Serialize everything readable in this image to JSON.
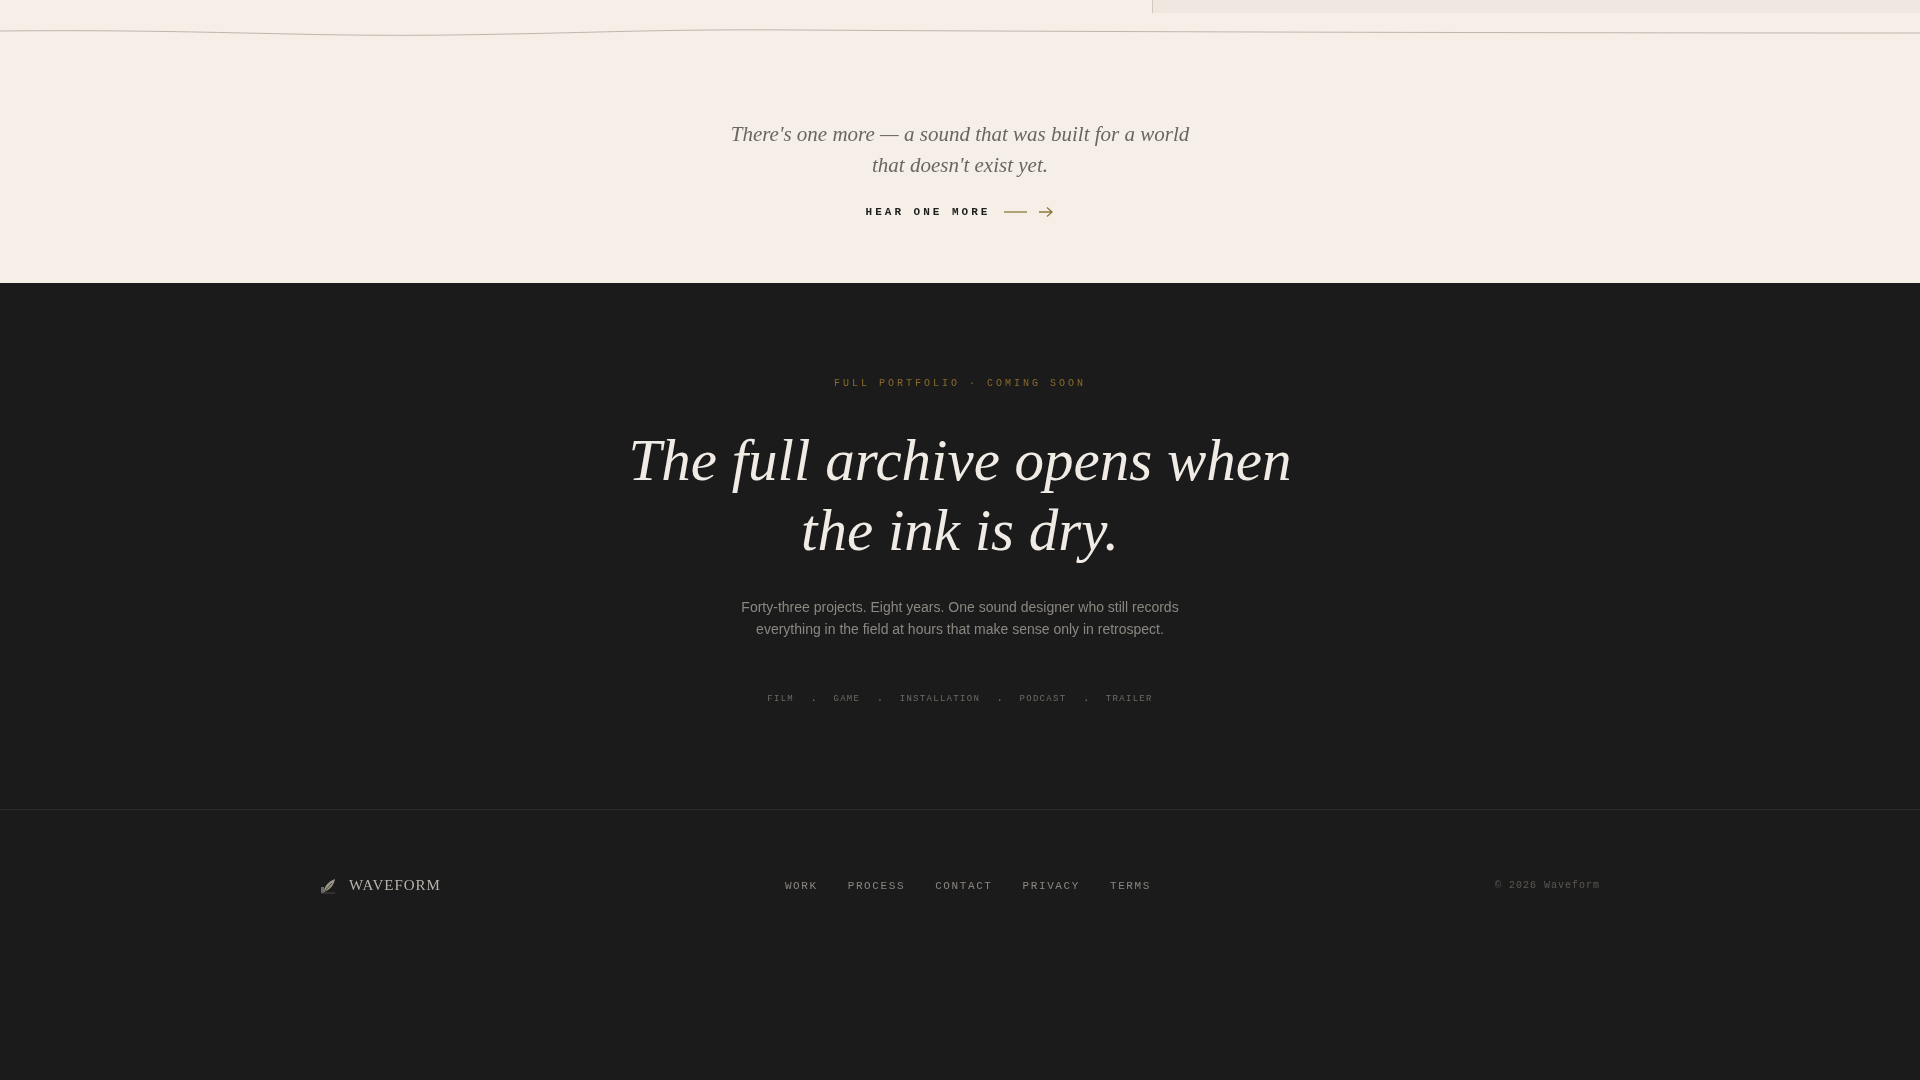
{
  "closing": {
    "quote": "There's one more — a sound that was built for a world that doesn't exist yet.",
    "link": {
      "label": "HEAR ONE MORE"
    }
  },
  "archive": {
    "eyebrow": "FULL PORTFOLIO · COMING SOON",
    "headline": "The full archive opens when the ink is dry.",
    "body": "Forty-three projects. Eight years. One sound designer who still records everything in the field at hours that make sense only in retrospect.",
    "tags": [
      {
        "kind": "tag",
        "label": "FILM"
      },
      {
        "kind": "separator",
        "label": "."
      },
      {
        "kind": "tag",
        "label": "GAME"
      },
      {
        "kind": "separator",
        "label": "."
      },
      {
        "kind": "tag",
        "label": "INSTALLATION"
      },
      {
        "kind": "separator",
        "label": "."
      },
      {
        "kind": "tag",
        "label": "PODCAST"
      },
      {
        "kind": "separator",
        "label": "."
      },
      {
        "kind": "tag",
        "label": "TRAILER"
      }
    ]
  },
  "footer": {
    "brand": "WAVEFORM",
    "nav": [
      {
        "label": "WORK"
      },
      {
        "label": "PROCESS"
      },
      {
        "label": "CONTACT"
      },
      {
        "label": "PRIVACY"
      },
      {
        "label": "TERMS"
      }
    ],
    "copyright": "© 2026 Waveform"
  }
}
